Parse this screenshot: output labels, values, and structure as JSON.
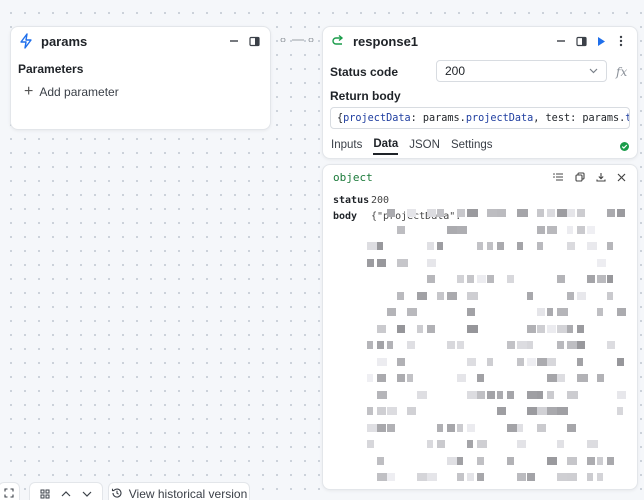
{
  "params_node": {
    "title": "params",
    "section_label": "Parameters",
    "add_button_label": "Add parameter"
  },
  "response_node": {
    "title": "response1",
    "status_code_label": "Status code",
    "status_code_value": "200",
    "fx_label": "fx",
    "return_body_label": "Return body",
    "return_body_code": {
      "open": "{ ",
      "key1": "projectData",
      "sep1": ": params.",
      "val1": "projectData",
      "sep2": ", test: params.",
      "val2": "test",
      "close": "}"
    },
    "tabs": [
      "Inputs",
      "Data",
      "JSON",
      "Settings"
    ],
    "active_tab": "Data"
  },
  "object_panel": {
    "type_label": "object",
    "rows": [
      {
        "key": "status",
        "value": "200"
      },
      {
        "key": "body",
        "value": "{\"projectData\":"
      }
    ]
  },
  "bottom_toolbar": {
    "history_label": "View historical version"
  },
  "colors": {
    "accent": "#1f6feb",
    "success": "#1a9c4a",
    "object_type": "#1b7a3a",
    "code_keyword": "#1f3ea0"
  },
  "icons": {
    "params": "lightning-icon",
    "response": "return-arrow-icon",
    "minimize": "minus-icon",
    "sidebar": "panel-icon",
    "run": "play-icon"
  }
}
